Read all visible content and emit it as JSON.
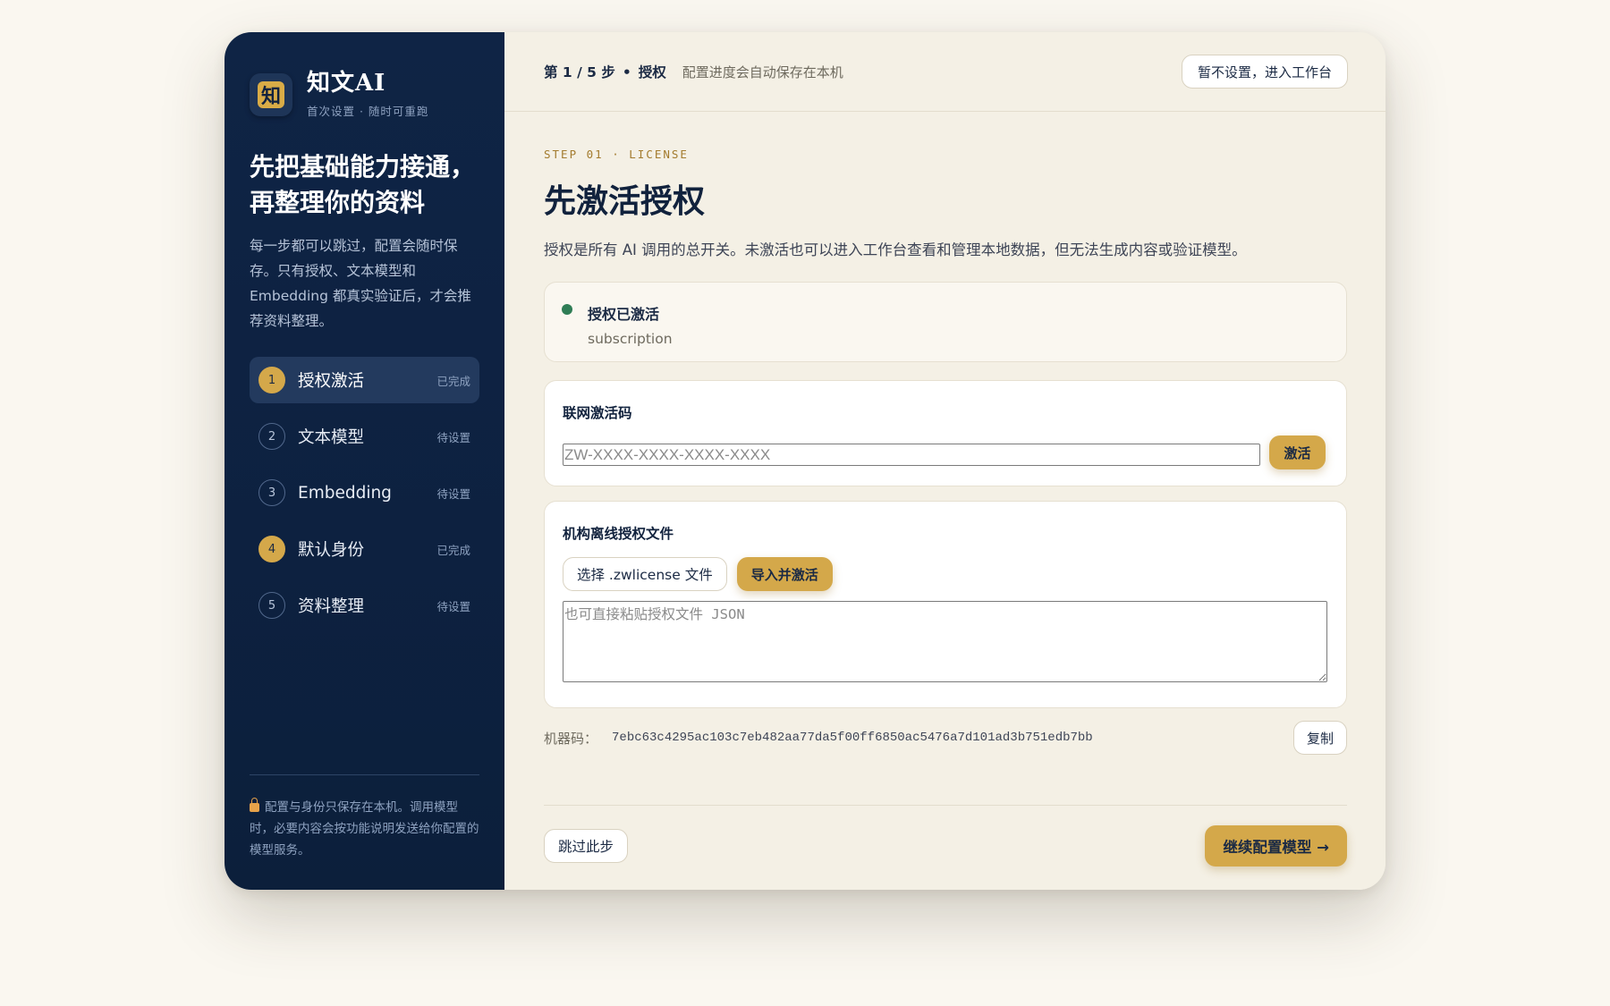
{
  "brand": {
    "logo_glyph": "知",
    "name": "知文AI",
    "subtitle": "首次设置 · 随时可重跑"
  },
  "sidebar": {
    "headline_line1": "先把基础能力接通，",
    "headline_line2": "再整理你的资料",
    "description": "每一步都可以跳过，配置会随时保存。只有授权、文本模型和 Embedding 都真实验证后，才会推荐资料整理。",
    "steps": [
      {
        "num": "1",
        "label": "授权激活",
        "state": "已完成",
        "done": true,
        "active": true
      },
      {
        "num": "2",
        "label": "文本模型",
        "state": "待设置",
        "done": false,
        "active": false
      },
      {
        "num": "3",
        "label": "Embedding",
        "state": "待设置",
        "done": false,
        "active": false
      },
      {
        "num": "4",
        "label": "默认身份",
        "state": "已完成",
        "done": true,
        "active": false
      },
      {
        "num": "5",
        "label": "资料整理",
        "state": "待设置",
        "done": false,
        "active": false
      }
    ],
    "footer_note": "配置与身份只保存在本机。调用模型时，必要内容会按功能说明发送给你配置的模型服务。"
  },
  "topbar": {
    "step_text": "第 1 / 5 步",
    "step_dot": "•",
    "step_name": "授权",
    "note": "配置进度会自动保存在本机",
    "skip_all_label": "暂不设置，进入工作台"
  },
  "main": {
    "eyebrow": "STEP 01 · LICENSE",
    "title": "先激活授权",
    "lead": "授权是所有 AI 调用的总开关。未激活也可以进入工作台查看和管理本地数据，但无法生成内容或验证模型。",
    "status": {
      "title": "授权已激活",
      "plan": "subscription",
      "color": "#2f7d55"
    },
    "online": {
      "label": "联网激活码",
      "placeholder": "ZW-XXXX-XXXX-XXXX-XXXX",
      "value": "",
      "activate_label": "激活"
    },
    "offline": {
      "label": "机构离线授权文件",
      "choose_label": "选择 .zwlicense 文件",
      "import_label": "导入并激活",
      "json_placeholder": "也可直接粘贴授权文件 JSON",
      "json_value": ""
    },
    "machine": {
      "label": "机器码：",
      "id": "7ebc63c4295ac103c7eb482aa77da5f00ff6850ac5476a7d101ad3b751edb7bb",
      "copy_label": "复制"
    },
    "footer": {
      "skip_label": "跳过此步",
      "next_label": "继续配置模型 →"
    }
  },
  "colors": {
    "sidebar_bg": "#0f2445",
    "accent_gold": "#d4a84a",
    "page_bg": "#f4f0e5",
    "success": "#2f7d55"
  }
}
